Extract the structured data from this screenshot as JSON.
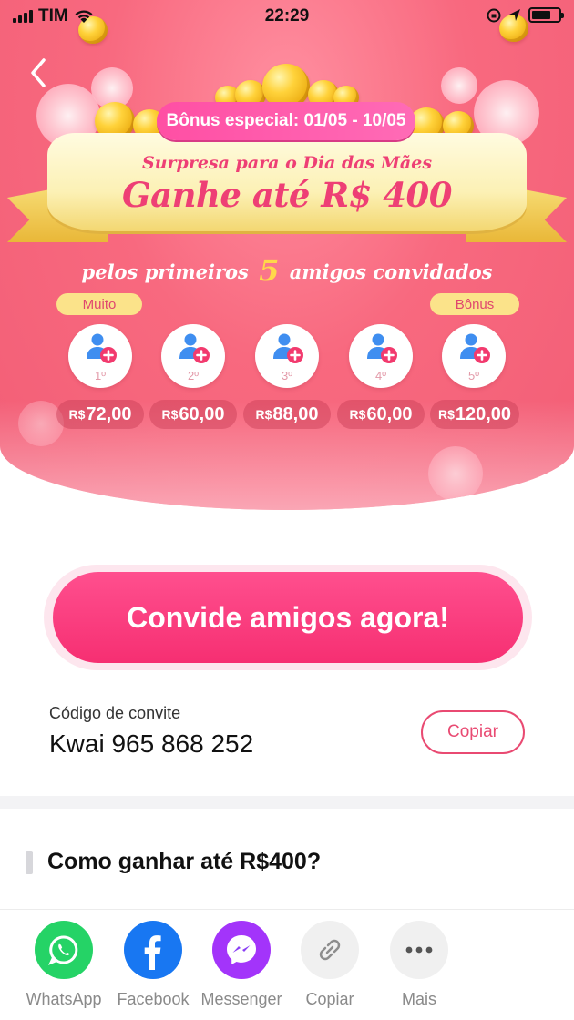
{
  "status_bar": {
    "carrier": "TIM",
    "time": "22:29"
  },
  "hero": {
    "bonus_pill": "Bônus especial: 01/05 - 10/05",
    "ribbon_line1": "Surpresa para o Dia das Mães",
    "ribbon_line2": "Ganhe até R$ 400",
    "subtitle_before": "pelos primeiros",
    "subtitle_number": "5",
    "subtitle_after": "amigos convidados",
    "tag_left": "Muito",
    "tag_right": "Bônus",
    "slots": [
      {
        "ord": "1º",
        "currency": "R$",
        "amount": "72,00"
      },
      {
        "ord": "2º",
        "currency": "R$",
        "amount": "60,00"
      },
      {
        "ord": "3º",
        "currency": "R$",
        "amount": "88,00"
      },
      {
        "ord": "4º",
        "currency": "R$",
        "amount": "60,00"
      },
      {
        "ord": "5º",
        "currency": "R$",
        "amount": "120,00"
      }
    ]
  },
  "invite": {
    "button_label": "Convide amigos agora!",
    "code_label": "Código de convite",
    "code_value": "Kwai 965 868 252",
    "copy_label": "Copiar"
  },
  "how": {
    "title": "Como ganhar até R$400?"
  },
  "share": {
    "items": [
      {
        "label": "WhatsApp",
        "icon": "whatsapp-icon",
        "color": "#25d366"
      },
      {
        "label": "Facebook",
        "icon": "facebook-icon",
        "color": "#1877f2"
      },
      {
        "label": "Messenger",
        "icon": "messenger-icon",
        "color": "#a334fa"
      },
      {
        "label": "Copiar",
        "icon": "link-icon",
        "color": "#f0f0f0"
      },
      {
        "label": "Mais",
        "icon": "more-icon",
        "color": "#f0f0f0"
      }
    ]
  },
  "colors": {
    "accent": "#f62f72",
    "hero": "#f8697f",
    "gold": "#ffd84a"
  }
}
